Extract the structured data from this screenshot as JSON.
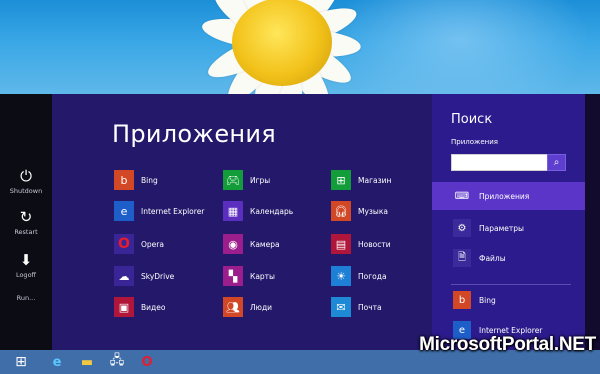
{
  "power_menu": {
    "items": [
      {
        "label": "Shutdown",
        "icon": "power-icon"
      },
      {
        "label": "Restart",
        "icon": "restart-icon"
      },
      {
        "label": "Logoff",
        "icon": "logoff-icon"
      },
      {
        "label": "Run...",
        "icon": ""
      }
    ]
  },
  "apps": {
    "title": "Приложения",
    "items": [
      {
        "label": "Bing",
        "icon": "bing-icon",
        "color": "#d24726"
      },
      {
        "label": "Internet Explorer",
        "icon": "ie-icon",
        "color": "#1e5ec8"
      },
      {
        "label": "Opera",
        "icon": "opera-icon",
        "color": "#3a2596"
      },
      {
        "label": "SkyDrive",
        "icon": "skydrive-icon",
        "color": "#3a2596"
      },
      {
        "label": "Видео",
        "icon": "video-icon",
        "color": "#b0163a"
      },
      {
        "label": "Игры",
        "icon": "games-icon",
        "color": "#139c3a"
      },
      {
        "label": "Календарь",
        "icon": "calendar-icon",
        "color": "#5b2ec0"
      },
      {
        "label": "Камера",
        "icon": "camera-icon",
        "color": "#9b1e8c"
      },
      {
        "label": "Карты",
        "icon": "maps-icon",
        "color": "#9b1e8c"
      },
      {
        "label": "Люди",
        "icon": "people-icon",
        "color": "#d24726"
      },
      {
        "label": "Магазин",
        "icon": "store-icon",
        "color": "#139c3a"
      },
      {
        "label": "Музыка",
        "icon": "music-icon",
        "color": "#d24726"
      },
      {
        "label": "Новости",
        "icon": "news-icon",
        "color": "#b0163a"
      },
      {
        "label": "Погода",
        "icon": "weather-icon",
        "color": "#1e7fd6"
      },
      {
        "label": "Почта",
        "icon": "mail-icon",
        "color": "#1e8ad6"
      }
    ]
  },
  "search": {
    "title": "Поиск",
    "scope_label": "Приложения",
    "value": "",
    "filters": [
      {
        "label": "Приложения",
        "icon": "keyboard-icon",
        "active": true
      },
      {
        "label": "Параметры",
        "icon": "gear-icon",
        "active": false
      },
      {
        "label": "Файлы",
        "icon": "file-icon",
        "active": false
      }
    ],
    "results": [
      {
        "label": "Bing",
        "icon": "bing-icon",
        "color": "#d24726"
      },
      {
        "label": "Internet Explorer",
        "icon": "ie-icon",
        "color": "#1e5ec8"
      }
    ]
  },
  "taskbar": {
    "items": [
      "windows-start-icon",
      "ie-icon",
      "explorer-icon",
      "network-icon",
      "opera-icon"
    ]
  },
  "watermark": "MicrosoftPortal.NET"
}
